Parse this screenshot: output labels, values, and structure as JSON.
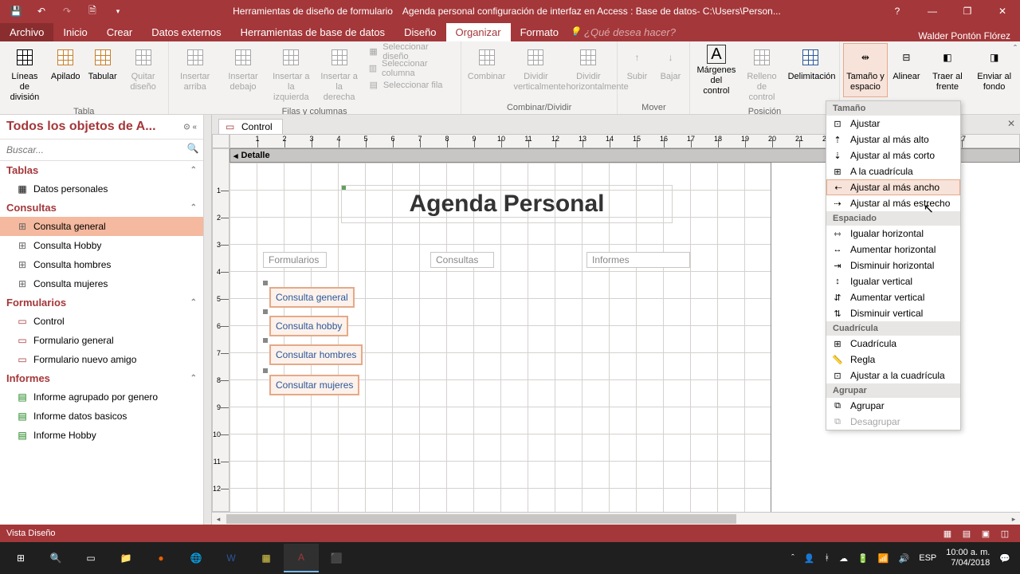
{
  "titlebar": {
    "tools_title": "Herramientas de diseño de formulario",
    "file_title": "Agenda personal configuración de interfaz en Access : Base de datos- C:\\Users\\Person..."
  },
  "tabs": {
    "file": "Archivo",
    "home": "Inicio",
    "create": "Crear",
    "external": "Datos externos",
    "dbtools": "Herramientas de base de datos",
    "design": "Diseño",
    "arrange": "Organizar",
    "format": "Formato",
    "tellme": "¿Qué desea hacer?",
    "user": "Walder Pontón Flórez"
  },
  "ribbon": {
    "lineas": "Líneas de división",
    "apilado": "Apilado",
    "tabular": "Tabular",
    "quitar": "Quitar diseño",
    "grp_tabla": "Tabla",
    "ins_arriba": "Insertar arriba",
    "ins_debajo": "Insertar debajo",
    "ins_izq": "Insertar a la izquierda",
    "ins_der": "Insertar a la derecha",
    "sel_diseno": "Seleccionar diseño",
    "sel_col": "Seleccionar columna",
    "sel_fila": "Seleccionar fila",
    "grp_filas": "Filas y columnas",
    "combinar": "Combinar",
    "div_v": "Dividir verticalmente",
    "div_h": "Dividir horizontalmente",
    "grp_comb": "Combinar/Dividir",
    "subir": "Subir",
    "bajar": "Bajar",
    "grp_mover": "Mover",
    "margenes": "Márgenes del control",
    "relleno": "Relleno de control",
    "delim": "Delimitación",
    "grp_pos": "Posición",
    "tam": "Tamaño y espacio",
    "alinear": "Alinear",
    "frente": "Traer al frente",
    "fondo": "Enviar al fondo"
  },
  "nav": {
    "header": "Todos los objetos de A...",
    "search_placeholder": "Buscar...",
    "tablas": "Tablas",
    "tabla_items": [
      "Datos personales"
    ],
    "consultas": "Consultas",
    "consulta_items": [
      "Consulta general",
      "Consulta Hobby",
      "Consulta hombres",
      "Consulta mujeres"
    ],
    "formularios": "Formularios",
    "form_items": [
      "Control",
      "Formulario general",
      "Formulario nuevo amigo"
    ],
    "informes": "Informes",
    "informe_items": [
      "Informe agrupado por genero",
      "Informe datos basicos",
      "Informe Hobby"
    ]
  },
  "doc": {
    "tab_name": "Control",
    "section": "Detalle",
    "title_label": "Agenda Personal",
    "labels": [
      "Formularios",
      "Consultas",
      "Informes"
    ],
    "buttons": [
      "Consulta general",
      "Consulta hobby",
      "Consultar hombres",
      "Consultar mujeres"
    ]
  },
  "menu": {
    "tamano": "Tamaño",
    "ajustar": "Ajustar",
    "alto": "Ajustar al más alto",
    "corto": "Ajustar al más corto",
    "cuadricula": "A la cuadrícula",
    "ancho": "Ajustar al más ancho",
    "estrecho": "Ajustar al más estrecho",
    "espaciado": "Espaciado",
    "ig_h": "Igualar horizontal",
    "au_h": "Aumentar horizontal",
    "di_h": "Disminuir horizontal",
    "ig_v": "Igualar vertical",
    "au_v": "Aumentar vertical",
    "di_v": "Disminuir vertical",
    "cuad_h": "Cuadrícula",
    "cuad": "Cuadrícula",
    "regla": "Regla",
    "ajcuad": "Ajustar a la cuadrícula",
    "agrupar_h": "Agrupar",
    "agrupar": "Agrupar",
    "desagrupar": "Desagrupar"
  },
  "status": {
    "view": "Vista Diseño"
  },
  "tray": {
    "time": "10:00 a. m.",
    "date": "7/04/2018"
  }
}
